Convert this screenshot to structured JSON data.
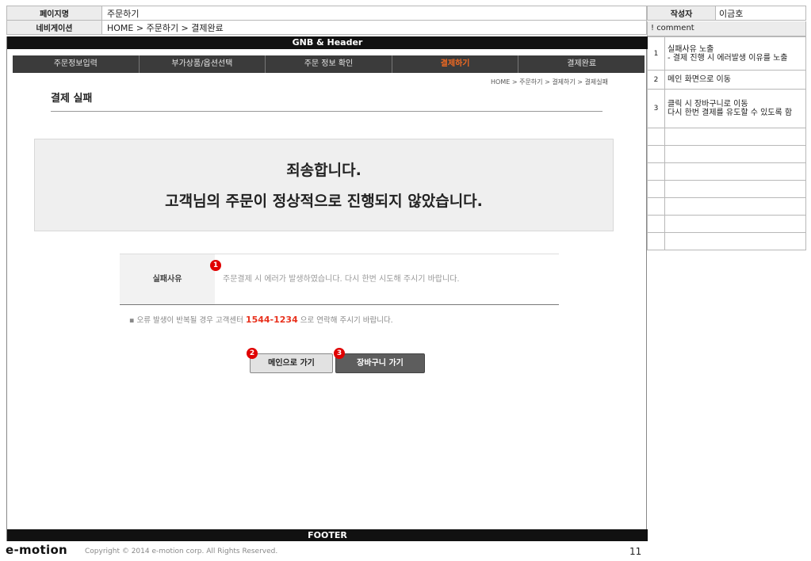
{
  "meta": {
    "page_name_label": "페이지명",
    "page_name_value": "주문하기",
    "nav_label": "네비게이션",
    "nav_value": "HOME > 주문하기 > 결제완료",
    "author_label": "작성자",
    "author_value": "이금호"
  },
  "comment": {
    "header": "! comment",
    "rows": [
      {
        "num": "1",
        "text": "실패사유 노출\n- 결제 진행 시 에러발생 이유를 노출"
      },
      {
        "num": "2",
        "text": "메인 화면으로 이동"
      },
      {
        "num": "3",
        "text": "클릭 시 장바구니로 이동\n다시 한번 결제를 유도할 수 있도록 함"
      },
      {
        "num": "",
        "text": ""
      },
      {
        "num": "",
        "text": ""
      },
      {
        "num": "",
        "text": ""
      },
      {
        "num": "",
        "text": ""
      },
      {
        "num": "",
        "text": ""
      },
      {
        "num": "",
        "text": ""
      },
      {
        "num": "",
        "text": ""
      }
    ]
  },
  "gnb": {
    "label": "GNB & Header"
  },
  "steps": [
    {
      "label": "주문정보입력",
      "active": false
    },
    {
      "label": "부가상품/옵션선택",
      "active": false
    },
    {
      "label": "주문 정보 확인",
      "active": false
    },
    {
      "label": "결제하기",
      "active": true
    },
    {
      "label": "결제완료",
      "active": false
    }
  ],
  "breadcrumb": "HOME >  주문하기 > 결제하기 > 결제실패",
  "page_title": "결제 실패",
  "fail_message": {
    "line1": "죄송합니다.",
    "line2": "고객님의 주문이 정상적으로 진행되지 않았습니다."
  },
  "reason": {
    "label": "실패사유",
    "value": "주문결제 시 에러가 발생하였습니다. 다시 한번 시도해 주시기 바랍니다."
  },
  "note": {
    "prefix": "▪ 오류 발생이 반복될 경우 고객센터 ",
    "phone": "1544-1234",
    "suffix": " 으로 연락해 주시기 바랍니다."
  },
  "buttons": {
    "main": "메인으로 가기",
    "cart": "장바구니 가기"
  },
  "badges": [
    "1",
    "2",
    "3"
  ],
  "footer": {
    "bar_label": "FOOTER",
    "brand": "e-motion",
    "copyright": "Copyright © 2014 e-motion corp. All Rights Reserved.",
    "page_number": "11"
  },
  "colors": {
    "accent": "#f16a22",
    "phone": "#e8321e",
    "badge": "#e00000"
  }
}
